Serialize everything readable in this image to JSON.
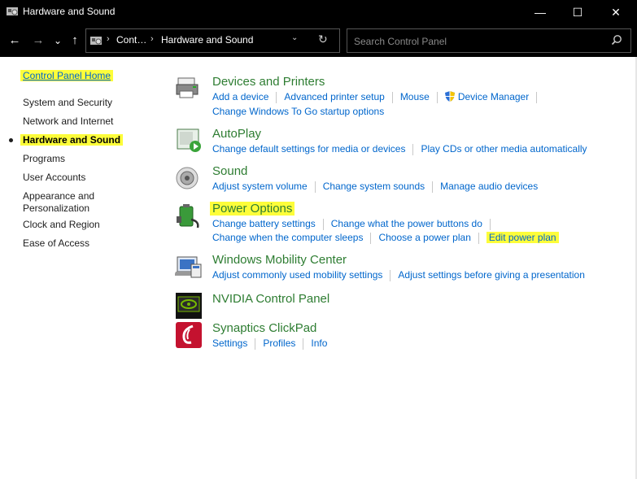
{
  "window": {
    "title": "Hardware and Sound",
    "minimize": "—",
    "maximize": "☐",
    "close": "✕"
  },
  "nav": {
    "back": "←",
    "forward": "→",
    "recent": "⌄",
    "up": "↑",
    "breadcrumb": [
      "Cont…",
      "Hardware and Sound"
    ],
    "breadcrumb_sep": "›",
    "dropdown": "⌄",
    "refresh": "↻",
    "search_placeholder": "Search Control Panel"
  },
  "sidebar": {
    "home": "Control Panel Home",
    "items": [
      {
        "label": "System and Security"
      },
      {
        "label": "Network and Internet"
      },
      {
        "label": "Hardware and Sound",
        "current": true
      },
      {
        "label": "Programs"
      },
      {
        "label": "User Accounts"
      },
      {
        "label": "Appearance and"
      },
      {
        "label": "Personalization"
      },
      {
        "label": "Clock and Region"
      },
      {
        "label": "Ease of Access"
      }
    ]
  },
  "categories": [
    {
      "title": "Devices and Printers",
      "link_rows": [
        [
          "Add a device",
          "Advanced printer setup",
          "Mouse",
          "Device Manager"
        ],
        [
          "Change Windows To Go startup options"
        ]
      ]
    },
    {
      "title": "AutoPlay",
      "link_rows": [
        [
          "Change default settings for media or devices",
          "Play CDs or other media automatically"
        ]
      ]
    },
    {
      "title": "Sound",
      "link_rows": [
        [
          "Adjust system volume",
          "Change system sounds",
          "Manage audio devices"
        ]
      ]
    },
    {
      "title": "Power Options",
      "link_rows": [
        [
          "Change battery settings",
          "Change what the power buttons do"
        ],
        [
          "Change when the computer sleeps",
          "Choose a power plan",
          "Edit power plan"
        ]
      ]
    },
    {
      "title": "Windows Mobility Center",
      "link_rows": [
        [
          "Adjust commonly used mobility settings",
          "Adjust settings before giving a presentation"
        ]
      ]
    },
    {
      "title": "NVIDIA Control Panel",
      "link_rows": []
    },
    {
      "title": "Synaptics ClickPad",
      "link_rows": [
        [
          "Settings",
          "Profiles",
          "Info"
        ]
      ]
    }
  ],
  "colors": {
    "link": "#0066cc",
    "category_title": "#2e7d32",
    "highlight": "#fdfd3a",
    "chrome": "#000000"
  }
}
